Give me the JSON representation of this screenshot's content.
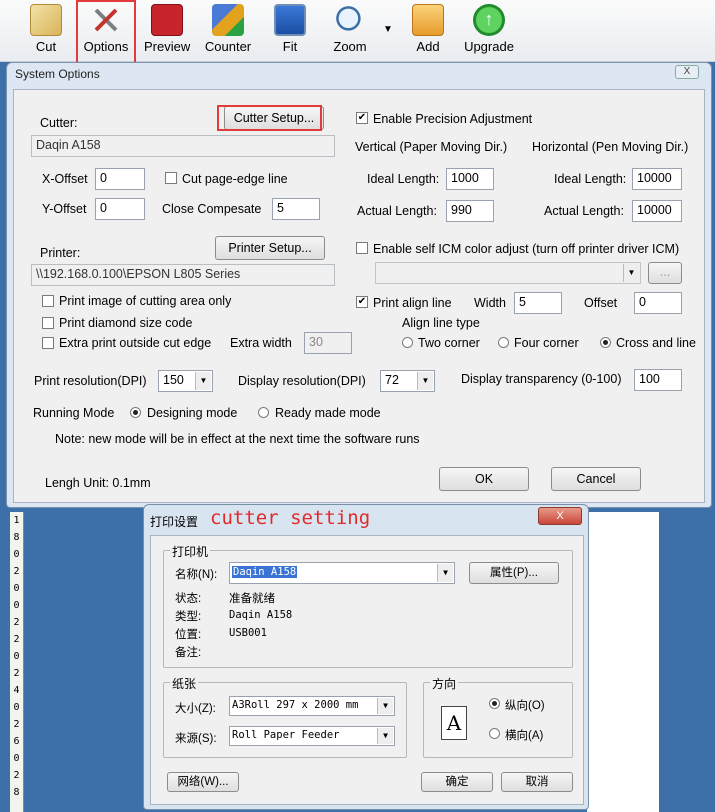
{
  "toolbar": {
    "items": [
      {
        "label": "Cut",
        "icon": "cut-icon"
      },
      {
        "label": "Options",
        "icon": "tools-icon"
      },
      {
        "label": "Preview",
        "icon": "preview-icon"
      },
      {
        "label": "Counter",
        "icon": "counter-icon"
      },
      {
        "label": "Fit",
        "icon": "fit-icon"
      },
      {
        "label": "Zoom",
        "icon": "zoom-icon"
      },
      {
        "label": "Add",
        "icon": "folder-add-icon"
      },
      {
        "label": "Upgrade",
        "icon": "upgrade-icon"
      }
    ],
    "highlighted": "Options"
  },
  "ruler": {
    "digits": [
      "1",
      "8",
      "0",
      "2",
      "0",
      "0",
      "2",
      "2",
      "0",
      "2",
      "4",
      "0",
      "2",
      "6",
      "0",
      "2",
      "8"
    ]
  },
  "system_options": {
    "title": "System Options",
    "close": "X",
    "cutter_label": "Cutter:",
    "cutter_setup_button": "Cutter Setup...",
    "cutter_value": "Daqin A158",
    "x_offset_label": "X-Offset",
    "x_offset": "0",
    "y_offset_label": "Y-Offset",
    "y_offset": "0",
    "cut_page_edge_label": "Cut page-edge line",
    "cut_page_edge_checked": false,
    "close_compesate_label": "Close Compesate",
    "close_compesate": "5",
    "enable_precision_label": "Enable Precision Adjustment",
    "enable_precision_checked": true,
    "vertical_header": "Vertical (Paper Moving Dir.)",
    "horizontal_header": "Horizontal (Pen Moving Dir.)",
    "ideal_length_label": "Ideal Length:",
    "actual_length_label": "Actual Length:",
    "v_ideal": "1000",
    "v_actual": "990",
    "h_ideal": "10000",
    "h_actual": "10000",
    "printer_label": "Printer:",
    "printer_setup_button": "Printer Setup...",
    "printer_value": "\\\\192.168.0.100\\EPSON L805 Series",
    "icm_label": "Enable self ICM color adjust (turn off printer driver ICM)",
    "icm_checked": false,
    "icm_browse": "...",
    "print_image_label": "Print image of cutting area only",
    "print_diamond_label": "Print diamond size code",
    "extra_print_label": "Extra print outside cut edge",
    "extra_width_label": "Extra width",
    "extra_width": "30",
    "print_align_label": "Print align line",
    "print_align_checked": true,
    "width_label": "Width",
    "width": "5",
    "offset_label": "Offset",
    "offset": "0",
    "align_type_label": "Align line type",
    "align_types": [
      "Two corner",
      "Four corner",
      "Cross and line"
    ],
    "align_type_selected": "Cross and line",
    "print_res_label": "Print resolution(DPI)",
    "print_res": "150",
    "display_res_label": "Display resolution(DPI)",
    "display_res": "72",
    "transparency_label": "Display transparency (0-100)",
    "transparency": "100",
    "running_mode_label": "Running Mode",
    "modes": [
      "Designing mode",
      "Ready made mode"
    ],
    "mode_selected": "Designing mode",
    "note": "Note: new mode will be in effect at the next time the software runs",
    "length_unit": "Lengh Unit: 0.1mm",
    "ok": "OK",
    "cancel": "Cancel"
  },
  "print_setup": {
    "title": "打印设置",
    "overlay_text": "cutter setting",
    "close": "X",
    "printer_group": "打印机",
    "name_label": "名称(N):",
    "name_value": "Daqin A158",
    "properties_button": "属性(P)...",
    "status_label": "状态:",
    "status_value": "准备就绪",
    "type_label": "类型:",
    "type_value": "Daqin A158",
    "location_label": "位置:",
    "location_value": "USB001",
    "comment_label": "备注:",
    "paper_group": "纸张",
    "size_label": "大小(Z):",
    "size_value": "A3Roll 297 x 2000 mm",
    "source_label": "来源(S):",
    "source_value": "Roll Paper Feeder",
    "orientation_group": "方向",
    "portrait": "纵向(O)",
    "landscape": "横向(A)",
    "orientation_selected": "portrait",
    "network_button": "网络(W)...",
    "ok_button": "确定",
    "cancel_button": "取消"
  }
}
